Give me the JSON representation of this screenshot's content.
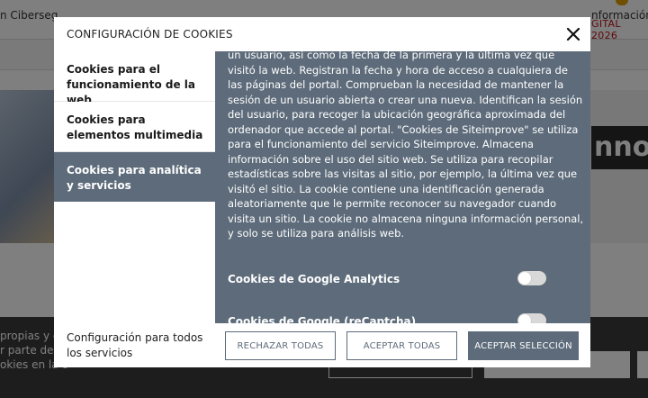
{
  "background": {
    "top_right_text": "GITAL 2026",
    "nav_left": "n Ciberseg",
    "nav_right": "nformación d",
    "hero_word": "nnov",
    "cookie_bar_lines": [
      "propias y de",
      "r parte del u",
      "okies en la c"
    ]
  },
  "modal": {
    "title": "CONFIGURACIÓN DE COOKIES",
    "close_icon": "close-icon",
    "sidebar": [
      {
        "label": "Cookies para el funcionamiento de la web",
        "active": false
      },
      {
        "label": "Cookies para elementos multimedia",
        "active": false
      },
      {
        "label": "Cookies para analítica y servicios",
        "active": true
      }
    ],
    "content": {
      "text": "un usuario, así como la fecha de la primera y la última vez que visitó la web. Registran la fecha y hora de acceso a cualquiera de las páginas del portal. Comprueban la necesidad de mantener la sesión de un usuario abierta o crear una nueva. Identifican la sesión del usuario, para recoger la ubicación geográfica aproximada del ordenador que accede al portal. \"Cookies de Siteimprove\" se utiliza para el funcionamiento del servicio Siteimprove. Almacena información sobre el uso del sitio web. Se utiliza para recopilar estadísticas sobre las visitas al sitio, por ejemplo, la última vez que visitó el sitio. La cookie contiene una identificación generada aleatoriamente que le permite reconocer su navegador cuando visita un sitio. La cookie no almacena ninguna información personal, y solo se utiliza para análisis web.",
      "toggles": [
        {
          "label": "Cookies de Google Analytics",
          "on": false
        },
        {
          "label": "Cookies de Google (reCaptcha)",
          "on": false
        }
      ]
    },
    "footer": {
      "note": "Configuración para todos los servicios",
      "reject_label": "RECHAZAR TODAS",
      "accept_all_label": "ACEPTAR TODAS",
      "accept_selection_label": "ACEPTAR SELECCIÓN"
    }
  },
  "colors": {
    "accent": "#5d6b7a",
    "overlay": "rgba(0,0,0,0.5)"
  }
}
